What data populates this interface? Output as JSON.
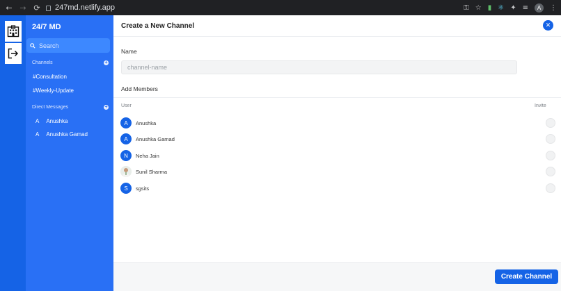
{
  "browser": {
    "url": "247md.netlify.app",
    "profile_initial": "A"
  },
  "sidebar": {
    "brand": "24/7 MD",
    "search_label": "Search",
    "channels_heading": "Channels",
    "channels": [
      "#Consultation",
      "#Weekly-Update"
    ],
    "dm_heading": "Direct Messages",
    "direct_messages": [
      {
        "initial": "A",
        "name": "Anushka"
      },
      {
        "initial": "A",
        "name": "Anushka Gamad"
      }
    ]
  },
  "main": {
    "title": "Create a New Channel",
    "name_label": "Name",
    "name_placeholder": "channel-name",
    "name_value": "",
    "members_label": "Add Members",
    "col_user": "User",
    "col_invite": "Invite",
    "users": [
      {
        "initial": "A",
        "name": "Anushka",
        "avatar": "letter"
      },
      {
        "initial": "A",
        "name": "Anushka Gamad",
        "avatar": "letter"
      },
      {
        "initial": "N",
        "name": "Neha Jain",
        "avatar": "letter"
      },
      {
        "initial": "",
        "name": "Sunil Sharma",
        "avatar": "photo"
      },
      {
        "initial": "S",
        "name": "sgsits",
        "avatar": "letter"
      }
    ],
    "create_button": "Create Channel"
  },
  "colors": {
    "rail": "#1563e6",
    "sidebar": "#2970f5",
    "search": "#3d88ff",
    "accent": "#1563e6"
  }
}
